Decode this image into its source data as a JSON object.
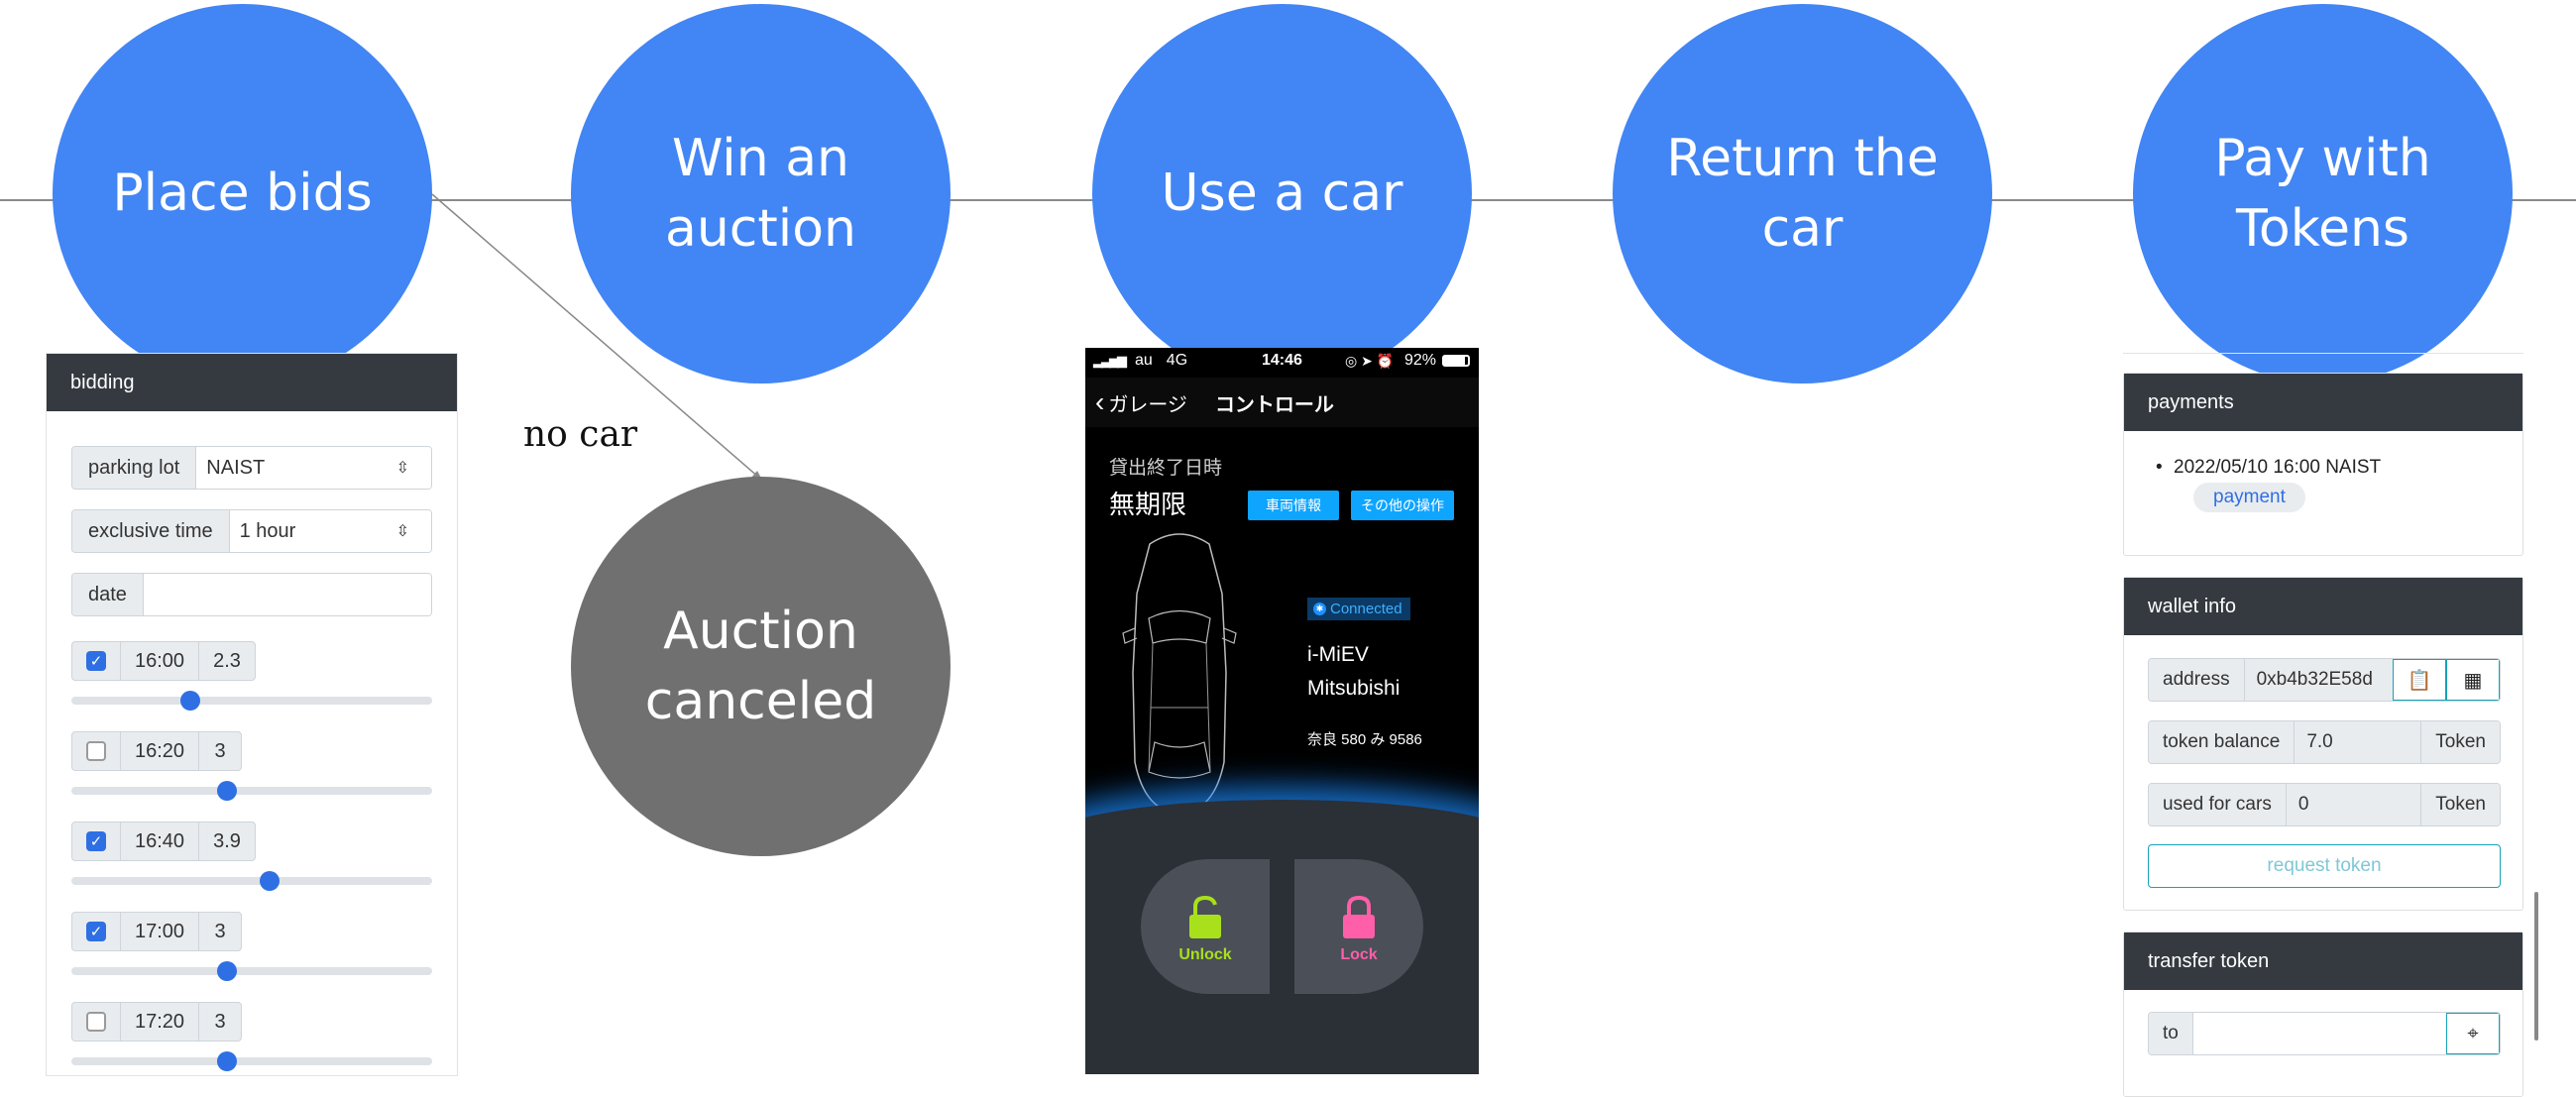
{
  "flow": {
    "steps": [
      {
        "label": "Place bids"
      },
      {
        "label": "Win an auction"
      },
      {
        "label": "Use a car"
      },
      {
        "label_line1": "Return the",
        "label_line2": "car"
      },
      {
        "label_line1": "Pay with",
        "label_line2": "Tokens"
      }
    ],
    "branch": {
      "arrow_label": "no car",
      "label_line1": "Auction",
      "label_line2": "canceled"
    }
  },
  "bidding": {
    "title": "bidding",
    "parking_lot_label": "parking lot",
    "parking_lot_value": "NAIST",
    "exclusive_time_label": "exclusive time",
    "exclusive_time_value": "1 hour",
    "date_label": "date",
    "date_value": "",
    "slots": [
      {
        "time": "16:00",
        "bid": "2.3",
        "checked": true,
        "level": 0.33
      },
      {
        "time": "16:20",
        "bid": "3",
        "checked": false,
        "level": 0.43
      },
      {
        "time": "16:40",
        "bid": "3.9",
        "checked": true,
        "level": 0.55
      },
      {
        "time": "17:00",
        "bid": "3",
        "checked": true,
        "level": 0.43
      },
      {
        "time": "17:20",
        "bid": "3",
        "checked": false,
        "level": 0.43
      }
    ]
  },
  "phone": {
    "carrier": "au",
    "network": "4G",
    "clock": "14:46",
    "battery": "92%",
    "back_label": "ガレージ",
    "screen_title": "コントロール",
    "rental_end_label": "貸出終了日時",
    "rental_end_value": "無期限",
    "vehicle_info_button": "車両情報",
    "other_ops_button": "その他の操作",
    "connection_status": "Connected",
    "car_model": "i-MiEV",
    "car_maker": "Mitsubishi",
    "plate": "奈良 580 み 9586",
    "unlock_label": "Unlock",
    "lock_label": "Lock",
    "unlock_color": "#a8e01c",
    "lock_color": "#ff5ea8"
  },
  "payments": {
    "title": "payments",
    "items": [
      {
        "text": "2022/05/10 16:00 NAIST",
        "badge": "payment"
      }
    ]
  },
  "wallet": {
    "title": "wallet info",
    "address_label": "address",
    "address_value": "0xb4b32E58d",
    "balance_label": "token balance",
    "balance_value": "7.0",
    "balance_unit": "Token",
    "used_label": "used for cars",
    "used_value": "0",
    "used_unit": "Token",
    "request_button": "request token"
  },
  "transfer": {
    "title": "transfer token",
    "to_label": "to",
    "to_value": ""
  },
  "colors": {
    "step": "#4285f4",
    "canceled": "#707070",
    "panel_header": "#343a40",
    "accent": "#2f6fe4"
  }
}
